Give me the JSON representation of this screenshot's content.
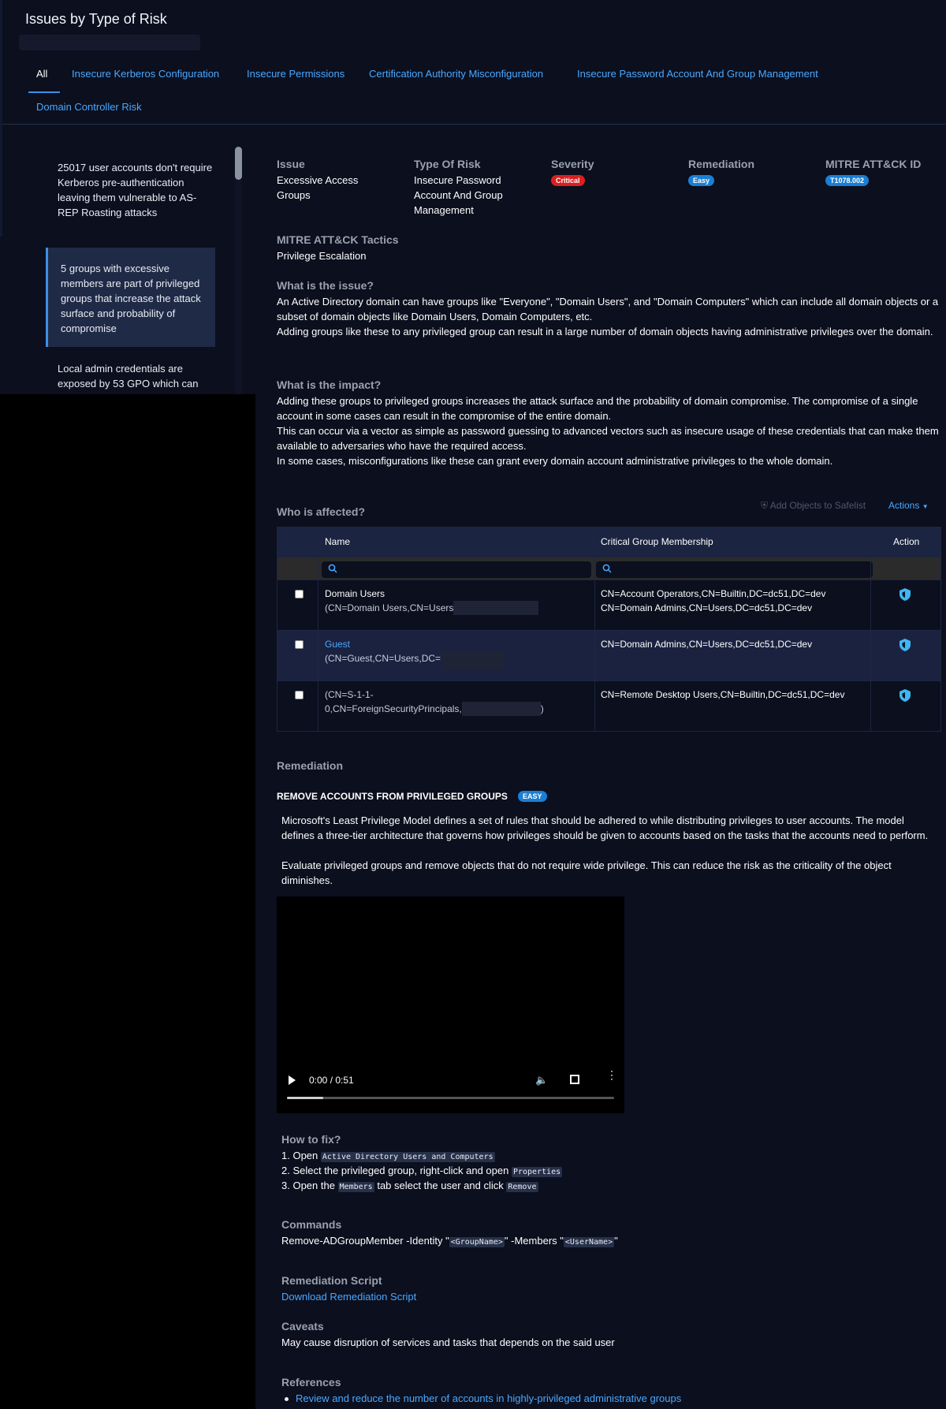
{
  "header": {
    "title": "Issues by Type of Risk"
  },
  "tabs": [
    {
      "label": "All",
      "active": true
    },
    {
      "label": "Insecure Kerberos Configuration"
    },
    {
      "label": "Insecure Permissions"
    },
    {
      "label": "Certification Authority Misconfiguration"
    },
    {
      "label": "Insecure Password Account And Group Management"
    },
    {
      "label": "Domain Controller Risk"
    }
  ],
  "issues": [
    {
      "text": "25017 user accounts don't require Kerberos pre-authentication leaving them vulnerable to AS-REP Roasting attacks"
    },
    {
      "text": "5 groups with excessive members are part of privileged groups that increase the attack surface and probability of compromise",
      "active": true
    },
    {
      "text": "Local admin credentials are exposed by 53 GPO which can"
    }
  ],
  "detail": {
    "issue_label": "Issue",
    "issue_value": "Excessive Access Groups",
    "type_label": "Type Of Risk",
    "type_value": "Insecure Password Account And Group Management",
    "severity_label": "Severity",
    "severity_value": "Critical",
    "remediation_label": "Remediation",
    "remediation_value": "Easy",
    "mitre_id_label": "MITRE ATT&CK ID",
    "mitre_id_value": "T1078.002",
    "tactics_label": "MITRE ATT&CK Tactics",
    "tactics_value": "Privilege Escalation",
    "what_title": "What is the issue?",
    "what_p1": "An Active Directory domain can have groups like \"Everyone\", \"Domain Users\", and \"Domain Computers\" which can include all domain objects or a subset of domain objects like Domain Users, Domain Computers, etc.",
    "what_p2": "Adding groups like these to any privileged group can result in a large number of domain objects having administrative privileges over the domain.",
    "impact_title": "What is the impact?",
    "impact_p1": "Adding these groups to privileged groups increases the attack surface and the probability of domain compromise. The compromise of a single account in some cases can result in the compromise of the entire domain.",
    "impact_p2": "This can occur via a vector as simple as password guessing to advanced vectors such as insecure usage of these credentials that can make them available to adversaries who have the required access.",
    "impact_p3": "In some cases, misconfigurations like these can grant every domain account administrative privileges to the whole domain."
  },
  "affected": {
    "title": "Who is affected?",
    "safelist_label": "Add Objects to Safelist",
    "actions_label": "Actions",
    "columns": [
      "Name",
      "Critical Group Membership",
      "Action"
    ],
    "rows": [
      {
        "name": "Domain Users",
        "dn": "(CN=Domain Users,CN=Users",
        "groups": [
          "CN=Account Operators,CN=Builtin,DC=dc51,DC=dev",
          "CN=Domain Admins,CN=Users,DC=dc51,DC=dev"
        ]
      },
      {
        "name": "Guest",
        "dn": "(CN=Guest,CN=Users,DC=",
        "groups": [
          "CN=Domain Admins,CN=Users,DC=dc51,DC=dev"
        ]
      },
      {
        "name": "",
        "dn": "(CN=S-1-1-",
        "dn2": "0,CN=ForeignSecurityPrincipals,",
        "dn_close": ")",
        "groups": [
          "CN=Remote Desktop Users,CN=Builtin,DC=dc51,DC=dev"
        ]
      }
    ]
  },
  "remediation": {
    "title": "Remediation",
    "heading": "REMOVE ACCOUNTS FROM PRIVILEGED GROUPS",
    "badge": "EASY",
    "p1": "Microsoft's Least Privilege Model defines a set of rules that should be adhered to while distributing privileges to user accounts. The model defines a three-tier architecture that governs how privileges should be given to accounts based on the tasks that the accounts need to perform.",
    "p2": "Evaluate privileged groups and remove objects that do not require wide privilege. This can reduce the risk as the criticality of the object diminishes.",
    "video_time": "0:00 / 0:51",
    "video_progress": 0.11,
    "how_title": "How to fix?",
    "step1_pre": "1. Open ",
    "step1_code": "Active Directory Users and Computers",
    "step2_pre": "2. Select the privileged group, right-click and open ",
    "step2_code": "Properties",
    "step3_pre": "3. Open the ",
    "step3_code": "Members",
    "step3_mid": " tab select the user and click ",
    "step3_code2": "Remove",
    "commands_title": "Commands",
    "cmd_pre": "Remove-ADGroupMember -Identity \"",
    "cmd_code1": "<GroupName>",
    "cmd_mid": "\" -Members \"",
    "cmd_code2": "<UserName>",
    "cmd_post": "\"",
    "script_title": "Remediation Script",
    "script_link": "Download Remediation Script",
    "caveats_title": "Caveats",
    "caveats_text": "May cause disruption of services and tasks that depends on the said user",
    "refs_title": "References",
    "ref1": "Review and reduce the number of accounts in highly-privileged administrative groups"
  },
  "colors": {
    "accent": "#4aa8ff",
    "critical": "#d92020",
    "easy": "#1a7fd4",
    "background": "#0b0f1e"
  },
  "icons": [
    "search-icon",
    "shield-icon",
    "play-icon",
    "volume-icon",
    "fullscreen-icon",
    "more-icon",
    "chevron-down-icon"
  ]
}
